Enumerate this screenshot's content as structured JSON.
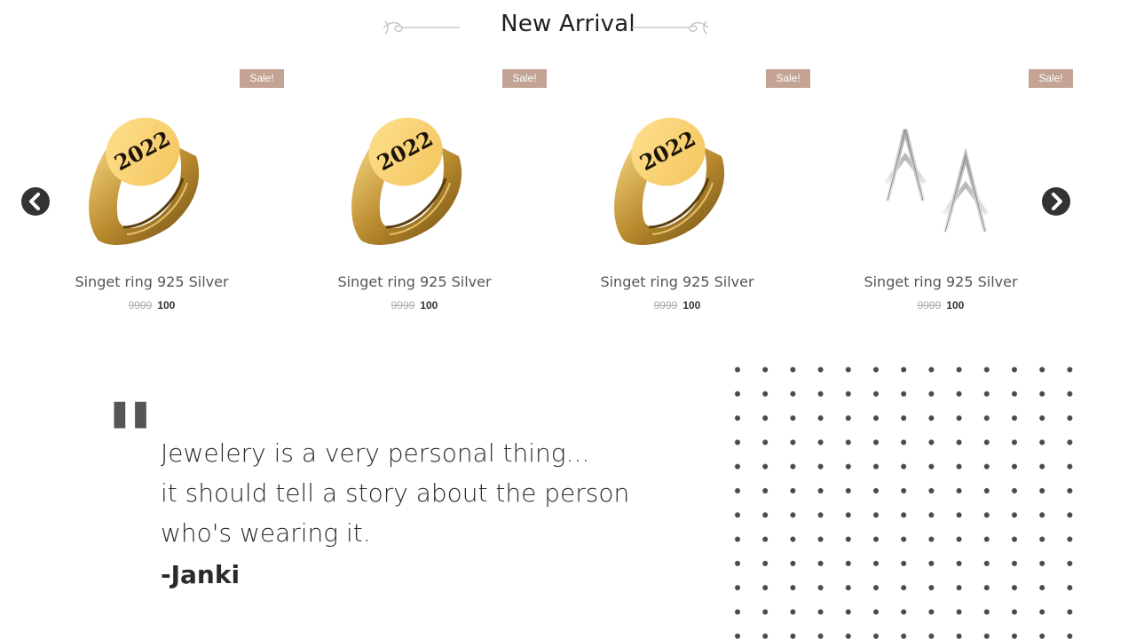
{
  "section": {
    "title": "New Arrival"
  },
  "carousel": {
    "products": [
      {
        "sale_badge": "Sale!",
        "name": "Singet ring 925 Silver",
        "old_price": "9999",
        "price": "100",
        "image": "signet-ring-icon"
      },
      {
        "sale_badge": "Sale!",
        "name": "Singet ring 925 Silver",
        "old_price": "9999",
        "price": "100",
        "image": "signet-ring-icon"
      },
      {
        "sale_badge": "Sale!",
        "name": "Singet ring 925 Silver",
        "old_price": "9999",
        "price": "100",
        "image": "signet-ring-icon"
      },
      {
        "sale_badge": "Sale!",
        "name": "Singet ring 925 Silver",
        "old_price": "9999",
        "price": "100",
        "image": "silver-earrings-icon"
      }
    ],
    "ring_engraving": "2022",
    "prev_icon": "chevron-left-icon",
    "next_icon": "chevron-right-icon"
  },
  "quote": {
    "lines": [
      "Jewelery is a very personal thing...",
      "it should tell a story about the person",
      "who's wearing it."
    ],
    "author": "-Janki"
  },
  "colors": {
    "sale_badge": "#c3a393",
    "gold": "#d8a84a",
    "arrow": "#333333",
    "dots": "#4a4a4a"
  }
}
